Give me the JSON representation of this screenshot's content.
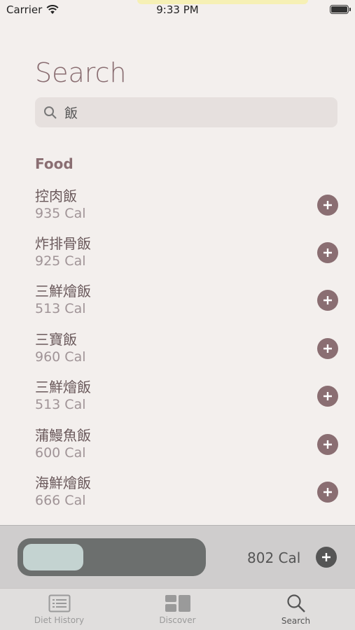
{
  "status": {
    "carrier": "Carrier",
    "time": "9:33 PM"
  },
  "page": {
    "title": "Search"
  },
  "search": {
    "query": "飯"
  },
  "section": {
    "title": "Food"
  },
  "foods": [
    {
      "name": "控肉飯",
      "calories": "935 Cal"
    },
    {
      "name": "炸排骨飯",
      "calories": "925 Cal"
    },
    {
      "name": "三鮮燴飯",
      "calories": "513 Cal"
    },
    {
      "name": "三寶飯",
      "calories": "960 Cal"
    },
    {
      "name": "三鮮燴飯",
      "calories": "513 Cal"
    },
    {
      "name": "蒲鰻魚飯",
      "calories": "600 Cal"
    },
    {
      "name": "海鮮燴飯",
      "calories": "666 Cal"
    }
  ],
  "summary": {
    "total_calories": "802 Cal",
    "progress_fraction": 0.34
  },
  "tabs": [
    {
      "label": "Diet History",
      "icon": "list-icon"
    },
    {
      "label": "Discover",
      "icon": "grid-icon"
    },
    {
      "label": "Search",
      "icon": "search-icon"
    }
  ],
  "colors": {
    "accent": "#8a6e72",
    "background": "#f3efed",
    "progress_track": "#6c6f6e",
    "progress_fill": "#c4d3d1"
  }
}
